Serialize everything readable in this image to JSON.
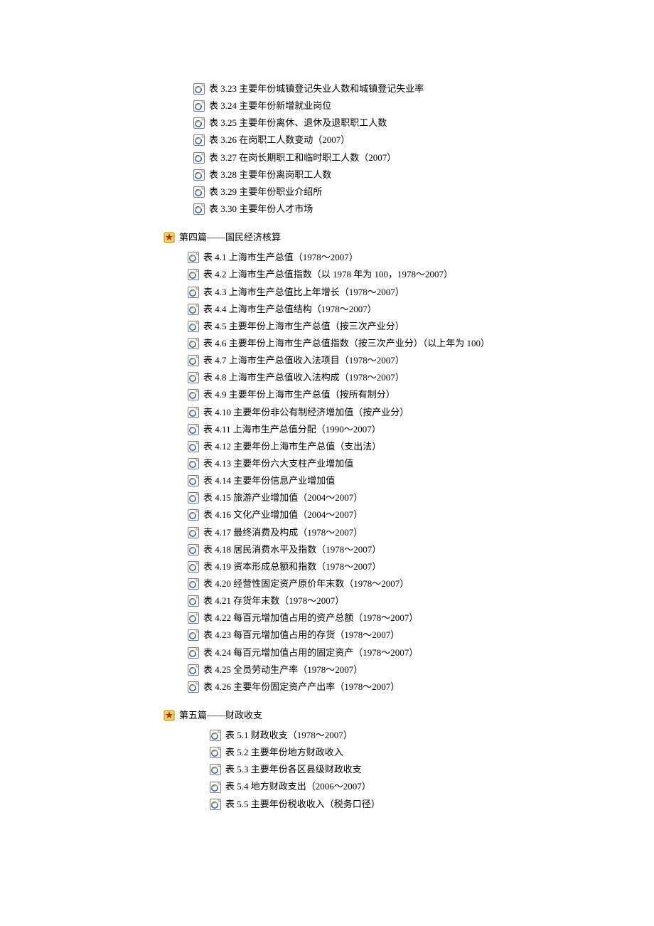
{
  "section3": {
    "items": [
      "表 3.23 主要年份城镇登记失业人数和城镇登记失业率",
      "表 3.24 主要年份新增就业岗位",
      "表 3.25 主要年份离休、退休及退职职工人数",
      "表 3.26 在岗职工人数变动（2007）",
      "表 3.27 在岗长期职工和临时职工人数（2007）",
      "表 3.28 主要年份离岗职工人数",
      "表 3.29 主要年份职业介绍所",
      "表 3.30 主要年份人才市场"
    ]
  },
  "section4": {
    "title": "第四篇——国民经济核算",
    "items": [
      "表 4.1 上海市生产总值（1978～2007）",
      "表 4.2 上海市生产总值指数（以 1978 年为 100，1978～2007）",
      "表 4.3 上海市生产总值比上年增长（1978～2007）",
      "表 4.4 上海市生产总值结构（1978～2007）",
      "表 4.5 主要年份上海市生产总值（按三次产业分）",
      "表 4.6 主要年份上海市生产总值指数（按三次产业分）（以上年为 100）",
      "表 4.7 上海市生产总值收入法项目（1978～2007）",
      "表 4.8 上海市生产总值收入法构成（1978～2007）",
      "表 4.9 主要年份上海市生产总值（按所有制分）",
      "表 4.10 主要年份非公有制经济增加值（按产业分）",
      "表 4.11 上海市生产总值分配（1990～2007）",
      "表 4.12 主要年份上海市生产总值（支出法）",
      "表 4.13 主要年份六大支柱产业增加值",
      "表 4.14 主要年份信息产业增加值",
      "表 4.15 旅游产业增加值（2004～2007）",
      "表 4.16 文化产业增加值（2004～2007）",
      "表 4.17 最终消费及构成（1978～2007）",
      "表 4.18 居民消费水平及指数（1978～2007）",
      "表 4.19 资本形成总额和指数（1978～2007）",
      "表 4.20 经营性固定资产原价年末数（1978～2007）",
      "表 4.21 存货年末数（1978～2007）",
      "表 4.22 每百元增加值占用的资产总额（1978～2007）",
      "表 4.23 每百元增加值占用的存货（1978～2007）",
      "表 4.24 每百元增加值占用的固定资产（1978～2007）",
      "表 4.25 全员劳动生产率（1978～2007）",
      "表 4.26 主要年份固定资产产出率（1978～2007）"
    ]
  },
  "section5": {
    "title": "第五篇——财政收支",
    "items": [
      "表 5.1 财政收支（1978～2007）",
      "表 5.2 主要年份地方财政收入",
      "表 5.3 主要年份各区县级财政收支",
      "表 5.4 地方财政支出（2006～2007）",
      "表 5.5 主要年份税收收入（税务口径）"
    ]
  }
}
